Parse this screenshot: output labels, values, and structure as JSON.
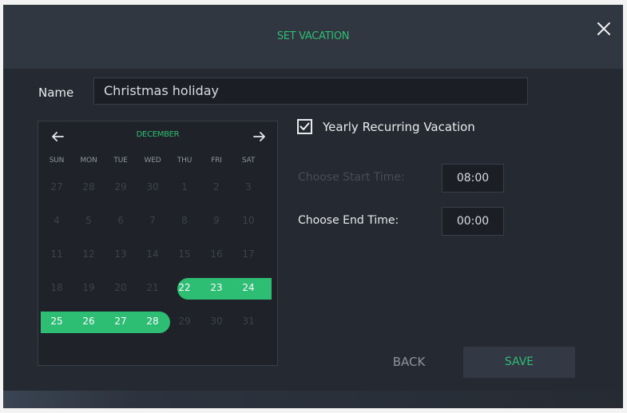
{
  "dialog": {
    "title": "SET VACATION",
    "close_icon": "close-icon"
  },
  "name_field": {
    "label": "Name",
    "value": "Christmas holiday"
  },
  "calendar": {
    "prev_icon": "arrow-left-icon",
    "next_icon": "arrow-right-icon",
    "month": "DECEMBER",
    "weekdays": [
      "SUN",
      "MON",
      "TUE",
      "WED",
      "THU",
      "FRI",
      "SAT"
    ],
    "weeks": [
      [
        "27",
        "28",
        "29",
        "30",
        "1",
        "2",
        "3"
      ],
      [
        "4",
        "5",
        "6",
        "7",
        "8",
        "9",
        "10"
      ],
      [
        "11",
        "12",
        "13",
        "14",
        "15",
        "16",
        "17"
      ],
      [
        "18",
        "19",
        "20",
        "21",
        "22",
        "23",
        "24"
      ],
      [
        "25",
        "26",
        "27",
        "28",
        "29",
        "30",
        "31"
      ]
    ],
    "selected_start": "22",
    "selected_end": "28",
    "selection_color": "#2dbd73"
  },
  "recurring": {
    "checked": true,
    "check_icon": "checkmark-icon",
    "label": "Yearly Recurring Vacation"
  },
  "start_time": {
    "label": "Choose Start Time:",
    "value": "08:00"
  },
  "end_time": {
    "label": "Choose End Time:",
    "value": "00:00"
  },
  "buttons": {
    "back": "BACK",
    "save": "SAVE"
  },
  "colors": {
    "accent": "#2dbd73",
    "background": "#252a32",
    "header": "#313741"
  }
}
